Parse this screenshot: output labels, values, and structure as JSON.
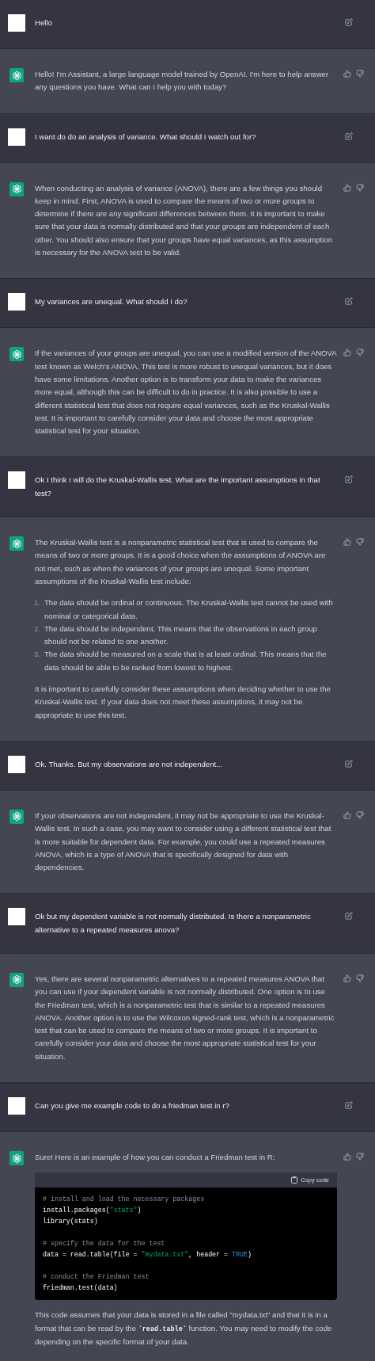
{
  "messages": [
    {
      "kind": "user",
      "blocks": [
        {
          "kind": "paragraph",
          "parts": [
            {
              "kind": "text",
              "text": "Hello"
            }
          ]
        }
      ]
    },
    {
      "kind": "assistant",
      "blocks": [
        {
          "kind": "paragraph",
          "parts": [
            {
              "kind": "text",
              "text": "Hello! I'm Assistant, a large language model trained by OpenAI. I'm here to help answer any questions you have. What can I help you with today?"
            }
          ]
        }
      ]
    },
    {
      "kind": "user",
      "blocks": [
        {
          "kind": "paragraph",
          "parts": [
            {
              "kind": "text",
              "text": "I want do do an analysis of variance. What should I watch out for?"
            }
          ]
        }
      ]
    },
    {
      "kind": "assistant",
      "blocks": [
        {
          "kind": "paragraph",
          "parts": [
            {
              "kind": "text",
              "text": "When conducting an analysis of variance (ANOVA), there are a few things you should keep in mind. First, ANOVA is used to compare the means of two or more groups to determine if there are any significant differences between them. It is important to make sure that your data is normally distributed and that your groups are independent of each other. You should also ensure that your groups have equal variances, as this assumption is necessary for the ANOVA test to be valid."
            }
          ]
        }
      ]
    },
    {
      "kind": "user",
      "blocks": [
        {
          "kind": "paragraph",
          "parts": [
            {
              "kind": "text",
              "text": "My variances are unequal. What should I do?"
            }
          ]
        }
      ]
    },
    {
      "kind": "assistant",
      "blocks": [
        {
          "kind": "paragraph",
          "parts": [
            {
              "kind": "text",
              "text": "If the variances of your groups are unequal, you can use a modified version of the ANOVA test known as Welch's ANOVA. This test is more robust to unequal variances, but it does have some limitations. Another option is to transform your data to make the variances more equal, although this can be difficult to do in practice. It is also possible to use a different statistical test that does not require equal variances, such as the Kruskal-Wallis test. It is important to carefully consider your data and choose the most appropriate statistical test for your situation."
            }
          ]
        }
      ]
    },
    {
      "kind": "user",
      "blocks": [
        {
          "kind": "paragraph",
          "parts": [
            {
              "kind": "text",
              "text": "Ok I think I will do the Kruskal-Wallis test. What are the important assumptions in that test?"
            }
          ]
        }
      ]
    },
    {
      "kind": "assistant",
      "blocks": [
        {
          "kind": "paragraph",
          "parts": [
            {
              "kind": "text",
              "text": "The Kruskal-Wallis test is a nonparametric statistical test that is used to compare the means of two or more groups. It is a good choice when the assumptions of ANOVA are not met, such as when the variances of your groups are unequal. Some important assumptions of the Kruskal-Wallis test include:"
            }
          ]
        },
        {
          "kind": "ordered_list",
          "items": [
            {
              "number": "1.",
              "text": "The data should be ordinal or continuous. The Kruskal-Wallis test cannot be used with nominal or categorical data."
            },
            {
              "number": "2.",
              "text": "The data should be independent. This means that the observations in each group should not be related to one another."
            },
            {
              "number": "3.",
              "text": "The data should be measured on a scale that is at least ordinal. This means that the data should be able to be ranked from lowest to highest."
            }
          ]
        },
        {
          "kind": "paragraph",
          "parts": [
            {
              "kind": "text",
              "text": "It is important to carefully consider these assumptions when deciding whether to use the Kruskal-Wallis test. If your data does not meet these assumptions, it may not be appropriate to use this test."
            }
          ]
        }
      ]
    },
    {
      "kind": "user",
      "blocks": [
        {
          "kind": "paragraph",
          "parts": [
            {
              "kind": "text",
              "text": "Ok. Thanks. But my observations are not independent..."
            }
          ]
        }
      ]
    },
    {
      "kind": "assistant",
      "blocks": [
        {
          "kind": "paragraph",
          "parts": [
            {
              "kind": "text",
              "text": "If your observations are not independent, it may not be appropriate to use the Kruskal-Wallis test. In such a case, you may want to consider using a different statistical test that is more suitable for dependent data. For example, you could use a repeated measures ANOVA, which is a type of ANOVA that is specifically designed for data with dependencies."
            }
          ]
        }
      ]
    },
    {
      "kind": "user",
      "blocks": [
        {
          "kind": "paragraph",
          "parts": [
            {
              "kind": "text",
              "text": "Ok but my dependent variable is not normally distributed. Is there a nonparametric alternative to a repeated measures anova?"
            }
          ]
        }
      ]
    },
    {
      "kind": "assistant",
      "blocks": [
        {
          "kind": "paragraph",
          "parts": [
            {
              "kind": "text",
              "text": "Yes, there are several nonparametric alternatives to a repeated measures ANOVA that you can use if your dependent variable is not normally distributed. One option is to use the Friedman test, which is a nonparametric test that is similar to a repeated measures ANOVA. Another option is to use the Wilcoxon signed-rank test, which is a nonparametric test that can be used to compare the means of two or more groups. It is important to carefully consider your data and choose the most appropriate statistical test for your situation."
            }
          ]
        }
      ]
    },
    {
      "kind": "user",
      "blocks": [
        {
          "kind": "paragraph",
          "parts": [
            {
              "kind": "text",
              "text": "Can you give me example code to do a friedman test in r?"
            }
          ]
        }
      ]
    },
    {
      "kind": "assistant",
      "blocks": [
        {
          "kind": "paragraph",
          "parts": [
            {
              "kind": "text",
              "text": "Sure! Here is an example of how you can conduct a Friedman test in R:"
            }
          ]
        },
        {
          "kind": "code",
          "copy_label": "Copy code",
          "lines": [
            {
              "kind": "code",
              "tokens": [
                {
                  "kind": "comment",
                  "text": "# install and load the necessary packages"
                }
              ]
            },
            {
              "kind": "code",
              "tokens": [
                {
                  "kind": "plain",
                  "text": "install.packages("
                },
                {
                  "kind": "string",
                  "text": "\"stats\""
                },
                {
                  "kind": "plain",
                  "text": ")"
                }
              ]
            },
            {
              "kind": "code",
              "tokens": [
                {
                  "kind": "plain",
                  "text": "library(stats)"
                }
              ]
            },
            {
              "kind": "blank"
            },
            {
              "kind": "code",
              "tokens": [
                {
                  "kind": "comment",
                  "text": "# specify the data for the test"
                }
              ]
            },
            {
              "kind": "code",
              "tokens": [
                {
                  "kind": "plain",
                  "text": "data = read.table(file = "
                },
                {
                  "kind": "string",
                  "text": "\"mydata.txt\""
                },
                {
                  "kind": "plain",
                  "text": ", header = "
                },
                {
                  "kind": "keyword",
                  "text": "TRUE"
                },
                {
                  "kind": "plain",
                  "text": ")"
                }
              ]
            },
            {
              "kind": "blank"
            },
            {
              "kind": "code",
              "tokens": [
                {
                  "kind": "comment",
                  "text": "# conduct the Friedman test"
                }
              ]
            },
            {
              "kind": "code",
              "tokens": [
                {
                  "kind": "plain",
                  "text": "friedman.test(data)"
                }
              ]
            }
          ]
        },
        {
          "kind": "paragraph",
          "parts": [
            {
              "kind": "text",
              "text": "This code assumes that your data is stored in a file called \"mydata.txt\" and that it is in a format that can be read by the "
            },
            {
              "kind": "code",
              "text": "`read.table`"
            },
            {
              "kind": "text",
              "text": " function. You may need to modify the code depending on the specific format of your data."
            }
          ]
        }
      ]
    }
  ]
}
